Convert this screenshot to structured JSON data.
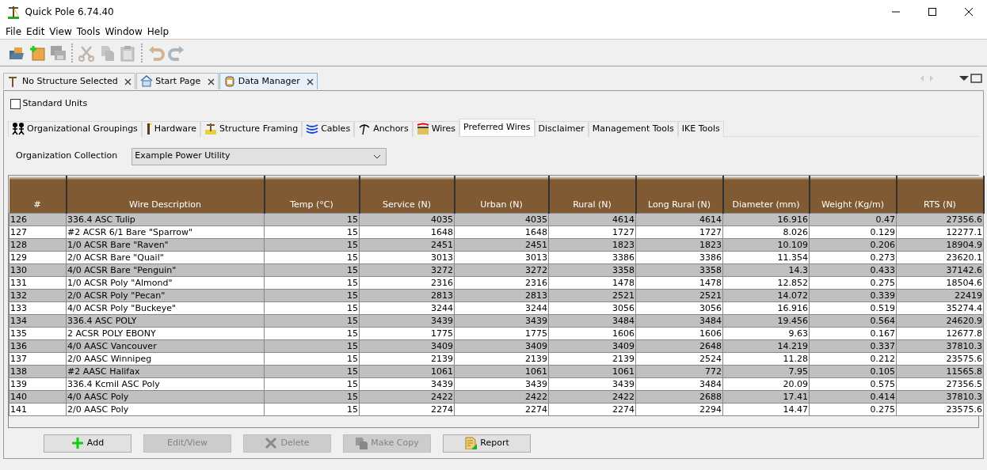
{
  "window": {
    "title": "Quick Pole 6.74.40"
  },
  "menu": [
    "File",
    "Edit",
    "View",
    "Tools",
    "Window",
    "Help"
  ],
  "toolbar": [
    {
      "kind": "open",
      "disabled": false
    },
    {
      "kind": "new",
      "disabled": false
    },
    {
      "kind": "save",
      "disabled": true
    },
    {
      "kind": "cut",
      "disabled": true
    },
    {
      "kind": "copy",
      "disabled": true
    },
    {
      "kind": "paste",
      "disabled": true
    },
    {
      "kind": "undo",
      "disabled": true
    },
    {
      "kind": "redo",
      "disabled": true
    }
  ],
  "doc_tabs": [
    {
      "label": "No Structure Selected",
      "kind": "pole",
      "selected": false
    },
    {
      "label": "Start Page",
      "kind": "house",
      "selected": false
    },
    {
      "label": "Data Manager",
      "kind": "database",
      "selected": true
    }
  ],
  "standard_units": {
    "label": "Standard Units",
    "checked": false
  },
  "data_tabs": [
    {
      "label": "Organizational Groupings",
      "kind": "people",
      "selected": false
    },
    {
      "label": "Hardware",
      "kind": "hardware",
      "selected": false
    },
    {
      "label": "Structure Framing",
      "kind": "framing",
      "selected": false
    },
    {
      "label": "Cables",
      "kind": "cables",
      "selected": false
    },
    {
      "label": "Anchors",
      "kind": "anchor",
      "selected": false
    },
    {
      "label": "Wires",
      "kind": "wires",
      "selected": false
    },
    {
      "label": "Preferred Wires",
      "kind": "none",
      "selected": true
    },
    {
      "label": "Disclaimer",
      "kind": "none",
      "selected": false
    },
    {
      "label": "Management Tools",
      "kind": "none",
      "selected": false
    },
    {
      "label": "IKE Tools",
      "kind": "none",
      "selected": false
    }
  ],
  "organization": {
    "label": "Organization Collection",
    "value": "Example Power Utility"
  },
  "table": {
    "columns": [
      "#",
      "Wire Description",
      "Temp (°C)",
      "Service (N)",
      "Urban (N)",
      "Rural (N)",
      "Long Rural (N)",
      "Diameter (mm)",
      "Weight (Kg/m)",
      "RTS (N)"
    ],
    "rows": [
      [
        "126",
        "336.4 ASC Tulip",
        "15",
        "4035",
        "4035",
        "4614",
        "4614",
        "16.916",
        "0.47",
        "27356.6"
      ],
      [
        "127",
        "#2 ACSR 6/1 Bare \"Sparrow\"",
        "15",
        "1648",
        "1648",
        "1727",
        "1727",
        "8.026",
        "0.129",
        "12277.1"
      ],
      [
        "128",
        "1/0 ACSR Bare \"Raven\"",
        "15",
        "2451",
        "2451",
        "1823",
        "1823",
        "10.109",
        "0.206",
        "18904.9"
      ],
      [
        "129",
        "2/0 ACSR Bare \"Quail\"",
        "15",
        "3013",
        "3013",
        "3386",
        "3386",
        "11.354",
        "0.273",
        "23620.1"
      ],
      [
        "130",
        "4/0 ACSR Bare \"Penguin\"",
        "15",
        "3272",
        "3272",
        "3358",
        "3358",
        "14.3",
        "0.433",
        "37142.6"
      ],
      [
        "131",
        "1/0 ACSR Poly \"Almond\"",
        "15",
        "2316",
        "2316",
        "1478",
        "1478",
        "12.852",
        "0.275",
        "18504.6"
      ],
      [
        "132",
        "2/0 ACSR Poly \"Pecan\"",
        "15",
        "2813",
        "2813",
        "2521",
        "2521",
        "14.072",
        "0.339",
        "22419"
      ],
      [
        "133",
        "4/0 ACSR Poly \"Buckeye\"",
        "15",
        "3244",
        "3244",
        "3056",
        "3056",
        "16.916",
        "0.519",
        "35274.4"
      ],
      [
        "134",
        "336.4 ASC POLY",
        "15",
        "3439",
        "3439",
        "3484",
        "3484",
        "19.456",
        "0.564",
        "24620.9"
      ],
      [
        "135",
        "2 ACSR POLY EBONY",
        "15",
        "1775",
        "1775",
        "1606",
        "1606",
        "9.63",
        "0.167",
        "12677.8"
      ],
      [
        "136",
        "4/0 AASC Vancouver",
        "15",
        "3409",
        "3409",
        "3409",
        "2648",
        "14.219",
        "0.337",
        "37810.3"
      ],
      [
        "137",
        "2/0 AASC Winnipeg",
        "15",
        "2139",
        "2139",
        "2139",
        "2524",
        "11.28",
        "0.212",
        "23575.6"
      ],
      [
        "138",
        "#2 AASC Halifax",
        "15",
        "1061",
        "1061",
        "1061",
        "772",
        "7.95",
        "0.105",
        "11565.8"
      ],
      [
        "139",
        "336.4 Kcmil ASC Poly",
        "15",
        "3439",
        "3439",
        "3439",
        "3484",
        "20.09",
        "0.575",
        "27356.5"
      ],
      [
        "140",
        "4/0 AASC Poly",
        "15",
        "2422",
        "2422",
        "2422",
        "2688",
        "17.41",
        "0.414",
        "37810.3"
      ],
      [
        "141",
        "2/0 AASC Poly",
        "15",
        "2274",
        "2274",
        "2274",
        "2294",
        "14.47",
        "0.275",
        "23575.6"
      ]
    ]
  },
  "buttons": [
    {
      "label": "Add",
      "kind": "add",
      "disabled": false
    },
    {
      "label": "Edit/View",
      "kind": "none",
      "disabled": true
    },
    {
      "label": "Delete",
      "kind": "delete",
      "disabled": true
    },
    {
      "label": "Make Copy",
      "kind": "copy",
      "disabled": true
    },
    {
      "label": "Report",
      "kind": "report",
      "disabled": false
    }
  ]
}
